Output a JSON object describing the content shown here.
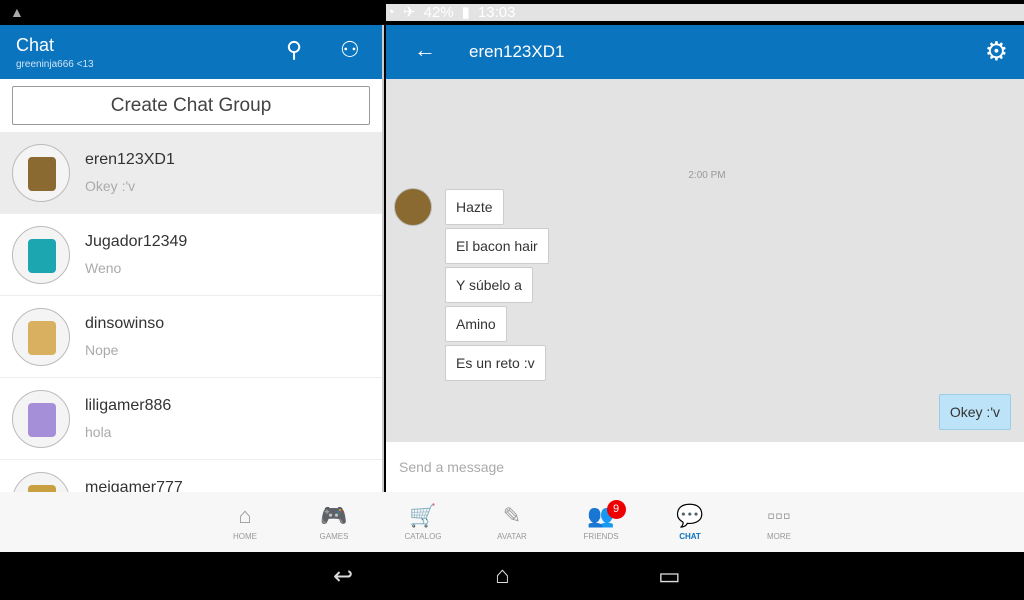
{
  "status": {
    "battery": "42%",
    "time": "13:03",
    "warning_icon": "warning-icon",
    "wifi_icon": "wifi-icon",
    "airplane_icon": "airplane-icon"
  },
  "sidebar": {
    "title": "Chat",
    "subtitle": "greeninja666 <13",
    "create_label": "Create Chat Group",
    "conversations": [
      {
        "name": "eren123XD1",
        "last": "Okey :'v",
        "color": "#8a6a30"
      },
      {
        "name": "Jugador12349",
        "last": "Weno",
        "color": "#1ba6b0"
      },
      {
        "name": "dinsowinso",
        "last": "Nope",
        "color": "#d8b060"
      },
      {
        "name": "liligamer886",
        "last": "hola",
        "color": "#a58fd8"
      },
      {
        "name": "meigamer777",
        "last": "",
        "color": "#c9a040"
      }
    ]
  },
  "chat": {
    "title": "eren123XD1",
    "timestamp": "2:00 PM",
    "incoming": [
      "Hazte",
      "El bacon hair",
      "Y súbelo a",
      "Amino",
      "Es un reto :v"
    ],
    "outgoing": [
      "Okey :'v"
    ],
    "input_placeholder": "Send a message"
  },
  "nav": {
    "items": [
      {
        "label": "HOME",
        "icon": "⌂"
      },
      {
        "label": "GAMES",
        "icon": "🎮"
      },
      {
        "label": "CATALOG",
        "icon": "🛒"
      },
      {
        "label": "AVATAR",
        "icon": "✎"
      },
      {
        "label": "FRIENDS",
        "icon": "👥",
        "badge": "9"
      },
      {
        "label": "CHAT",
        "icon": "💬"
      },
      {
        "label": "MORE",
        "icon": "▫▫▫"
      }
    ],
    "accent": "#0a74bf"
  }
}
